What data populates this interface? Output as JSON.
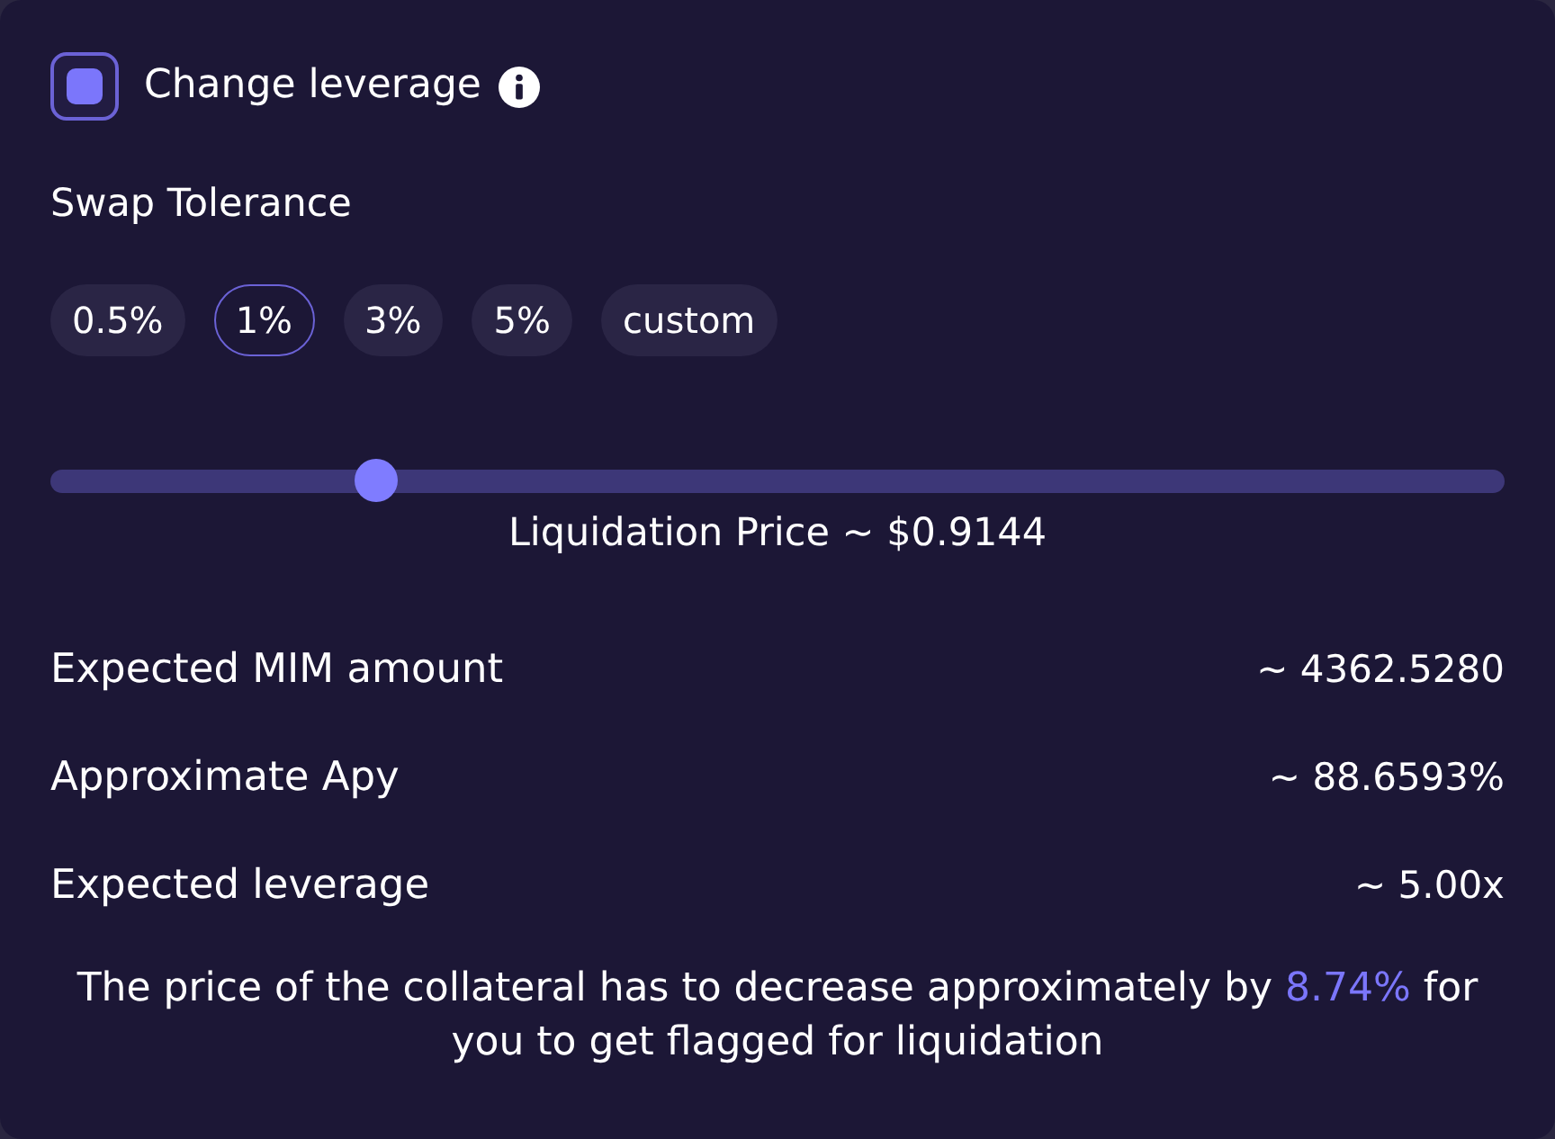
{
  "leverage": {
    "label": "Change leverage",
    "checked": true
  },
  "swap_tolerance": {
    "title": "Swap Tolerance",
    "options": [
      {
        "label": "0.5%",
        "selected": false
      },
      {
        "label": "1%",
        "selected": true
      },
      {
        "label": "3%",
        "selected": false
      },
      {
        "label": "5%",
        "selected": false
      },
      {
        "label": "custom",
        "selected": false
      }
    ]
  },
  "slider": {
    "level": 0.215,
    "caption": "Liquidation Price ~ $0.9144"
  },
  "stats": [
    {
      "label": "Expected MIM amount",
      "value": "~ 4362.5280"
    },
    {
      "label": "Approximate Apy",
      "value": "~ 88.6593%"
    },
    {
      "label": "Expected leverage",
      "value": "~ 5.00x"
    }
  ],
  "note": {
    "before": "The price of the collateral has to decrease approximately by",
    "highlight": "8.74%",
    "after": "for you to get flagged for liquidation"
  }
}
